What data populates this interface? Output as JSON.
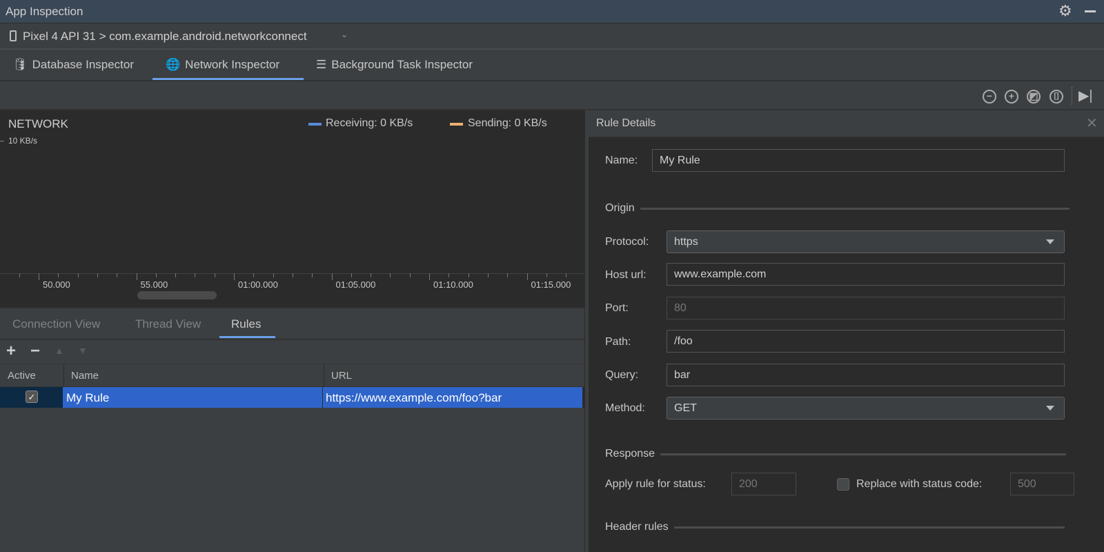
{
  "window": {
    "title": "App Inspection"
  },
  "device": {
    "label": "Pixel 4 API 31 > com.example.android.networkconnect"
  },
  "tabs": [
    {
      "label": "Database Inspector"
    },
    {
      "label": "Network Inspector",
      "active": true
    },
    {
      "label": "Background Task Inspector"
    }
  ],
  "chart": {
    "title": "NETWORK",
    "y_label": "10 KB/s",
    "legend": [
      {
        "label": "Receiving: 0 KB/s",
        "color": "#5a8ad6"
      },
      {
        "label": "Sending: 0 KB/s",
        "color": "#f0b070"
      }
    ],
    "ticks": [
      "50.000",
      "55.000",
      "01:00.000",
      "01:05.000",
      "01:10.000",
      "01:15.000"
    ]
  },
  "lower_tabs": [
    {
      "label": "Connection View"
    },
    {
      "label": "Thread View"
    },
    {
      "label": "Rules",
      "active": true
    }
  ],
  "table": {
    "headers": [
      "Active",
      "Name",
      "URL"
    ],
    "rows": [
      {
        "active": true,
        "name": "My Rule",
        "url": "https://www.example.com/foo?bar"
      }
    ]
  },
  "rule_details": {
    "title": "Rule Details",
    "name_label": "Name:",
    "name_value": "My Rule",
    "origin": "Origin",
    "protocol_label": "Protocol:",
    "protocol_value": "https",
    "host_label": "Host url:",
    "host_value": "www.example.com",
    "port_label": "Port:",
    "port_placeholder": "80",
    "path_label": "Path:",
    "path_value": "/foo",
    "query_label": "Query:",
    "query_value": "bar",
    "method_label": "Method:",
    "method_value": "GET",
    "response": "Response",
    "apply_label": "Apply rule for status:",
    "apply_placeholder": "200",
    "replace_label": "Replace with status code:",
    "replace_placeholder": "500",
    "replace_checked": false,
    "header_rules": "Header rules"
  },
  "colors": {
    "accent": "#6a9fe8",
    "selection": "#2f65ca"
  }
}
